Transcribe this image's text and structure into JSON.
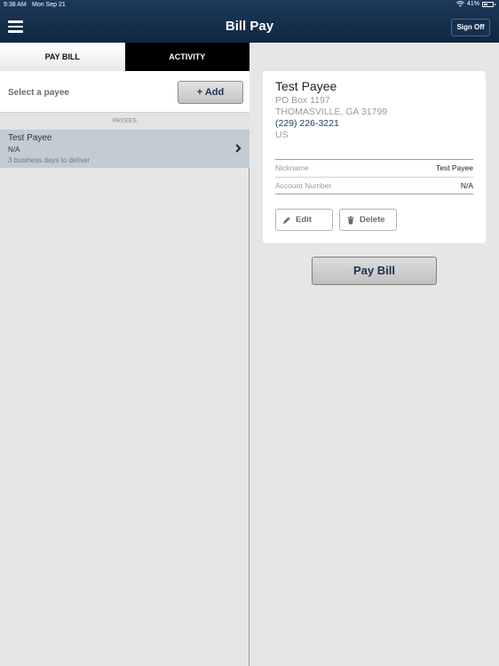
{
  "status_bar": {
    "time": "9:38 AM",
    "date": "Mon Sep 21",
    "battery": "41%"
  },
  "header": {
    "title": "Bill Pay",
    "sign_off_label": "Sign Off"
  },
  "tabs": [
    {
      "label": "PAY BILL",
      "selected": true
    },
    {
      "label": "ACTIVITY",
      "selected": false
    }
  ],
  "select_row": {
    "prompt": "Select a payee",
    "add_label": "+ Add"
  },
  "payees_header": "PAYEES",
  "payees": [
    {
      "name": "Test Payee",
      "account": "N/A",
      "delivery": "3 business days to deliver"
    }
  ],
  "detail": {
    "name": "Test Payee",
    "address1": "PO Box 1197",
    "address2": "THOMASVILLE, GA 31799",
    "phone": "(229) 226-3221",
    "country": "US",
    "fields": [
      {
        "label": "Nickname",
        "value": "Test Payee"
      },
      {
        "label": "Account Number",
        "value": "N/A"
      }
    ],
    "edit_label": "Edit",
    "delete_label": "Delete"
  },
  "pay_bill_label": "Pay Bill",
  "colors": {
    "header": "#0f2640",
    "accent": "#1e3150",
    "selected_row": "#c2ccd5"
  }
}
